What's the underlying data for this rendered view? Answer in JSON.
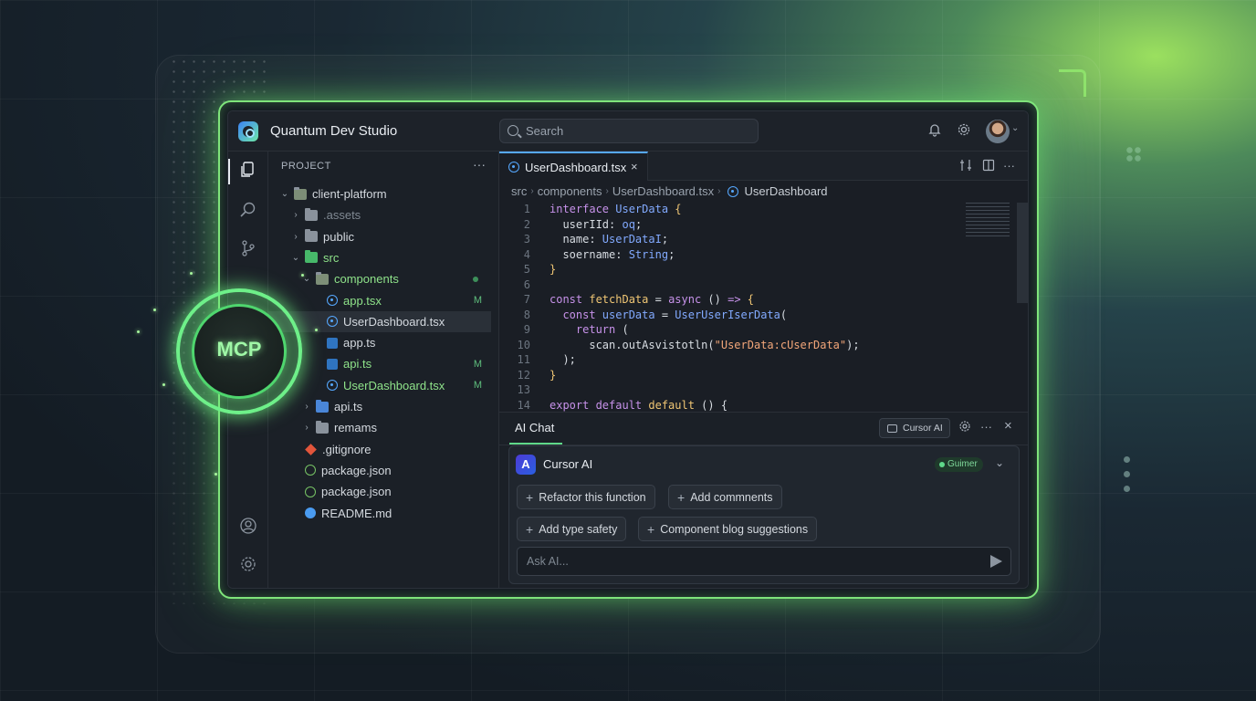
{
  "app": {
    "title": "Quantum Dev Studio"
  },
  "search": {
    "placeholder": "Search"
  },
  "explorer": {
    "header": "PROJECT",
    "more": "···",
    "rows": [
      {
        "name": "client-platform",
        "kind": "folder-open",
        "indent": 0,
        "chevron": "open"
      },
      {
        "name": ".assets",
        "kind": "folder",
        "indent": 1,
        "chevron": "closed",
        "dim": true
      },
      {
        "name": "public",
        "kind": "folder",
        "indent": 1,
        "chevron": "closed"
      },
      {
        "name": "src",
        "kind": "folder-green",
        "indent": 1,
        "chevron": "open",
        "green": true
      },
      {
        "name": "components",
        "kind": "folder-open",
        "indent": 2,
        "chevron": "open",
        "green": true,
        "dot": true
      },
      {
        "name": "app.tsx",
        "kind": "react",
        "indent": 3,
        "green": true,
        "badge": "M"
      },
      {
        "name": "UserDashboard.tsx",
        "kind": "react",
        "indent": 3,
        "selected": true
      },
      {
        "name": "app.ts",
        "kind": "ts",
        "indent": 3
      },
      {
        "name": "api.ts",
        "kind": "ts",
        "indent": 3,
        "green": true,
        "badge": "M"
      },
      {
        "name": "UserDashboard.tsx",
        "kind": "react",
        "indent": 3,
        "green": true,
        "badge": "M"
      },
      {
        "name": "api.ts",
        "kind": "folder-blue",
        "indent": 2,
        "chevron": "closed"
      },
      {
        "name": "remams",
        "kind": "folder",
        "indent": 2,
        "chevron": "closed"
      },
      {
        "name": ".gitignore",
        "kind": "git",
        "indent": 1
      },
      {
        "name": "package.json",
        "kind": "json",
        "indent": 1
      },
      {
        "name": "package.json",
        "kind": "json",
        "indent": 1
      },
      {
        "name": "README.md",
        "kind": "info",
        "indent": 1
      }
    ]
  },
  "editor": {
    "tab": "UserDashboard.tsx",
    "tab_close": "×",
    "breadcrumb": [
      "src",
      "components",
      "UserDashboard.tsx",
      "UserDashboard"
    ],
    "lines": [
      {
        "n": "1",
        "code": [
          [
            "kw",
            "interface "
          ],
          [
            "ty",
            "UserData "
          ],
          [
            "fn",
            "{"
          ]
        ]
      },
      {
        "n": "2",
        "code": [
          [
            "nm",
            "  userIId: "
          ],
          [
            "ty",
            "oq"
          ],
          [
            "nm",
            ";"
          ]
        ]
      },
      {
        "n": "3",
        "code": [
          [
            "nm",
            "  name: "
          ],
          [
            "ty",
            "UserDataI"
          ],
          [
            "nm",
            ";"
          ]
        ]
      },
      {
        "n": "4",
        "code": [
          [
            "nm",
            "  soername: "
          ],
          [
            "ty",
            "String"
          ],
          [
            "nm",
            ";"
          ]
        ]
      },
      {
        "n": "5",
        "code": [
          [
            "fn",
            "}"
          ]
        ]
      },
      {
        "n": "6",
        "code": []
      },
      {
        "n": "7",
        "code": [
          [
            "kw",
            "const "
          ],
          [
            "fn",
            "fetchData "
          ],
          [
            "nm",
            "= "
          ],
          [
            "kw",
            "async "
          ],
          [
            "nm",
            "() "
          ],
          [
            "kw",
            "=> "
          ],
          [
            "fn",
            "{"
          ]
        ]
      },
      {
        "n": "8",
        "code": [
          [
            "kw",
            "  const "
          ],
          [
            "ty",
            "userData "
          ],
          [
            "nm",
            "= "
          ],
          [
            "ty",
            "UserUserIserData"
          ],
          [
            "nm",
            "("
          ]
        ]
      },
      {
        "n": "9",
        "code": [
          [
            "kw",
            "    return "
          ],
          [
            "nm",
            "("
          ]
        ]
      },
      {
        "n": "10",
        "code": [
          [
            "nm",
            "      scan.outAsvistotln("
          ],
          [
            "st",
            "\"UserData:cUserData\""
          ],
          [
            "nm",
            ");"
          ]
        ]
      },
      {
        "n": "11",
        "code": [
          [
            "nm",
            "  );"
          ]
        ]
      },
      {
        "n": "12",
        "code": [
          [
            "fn",
            "}"
          ]
        ]
      },
      {
        "n": "13",
        "code": []
      },
      {
        "n": "14",
        "code": [
          [
            "kw",
            "export default "
          ],
          [
            "fn",
            "default "
          ],
          [
            "nm",
            "() {"
          ]
        ]
      }
    ]
  },
  "chat": {
    "tab": "AI Chat",
    "cursor_button": "Cursor AI",
    "assistant": "Cursor AI",
    "assistant_logo": "A",
    "status": "Guimer",
    "chips": [
      "Refactor this function",
      "Add commnents",
      "Add type safety",
      "Component blog suggestions"
    ],
    "input_placeholder": "Ask AI..."
  },
  "badge": {
    "mcp": "MCP"
  },
  "colors": {
    "accent_glow": "#7fe57b",
    "brand_blue": "#56a8ff"
  }
}
